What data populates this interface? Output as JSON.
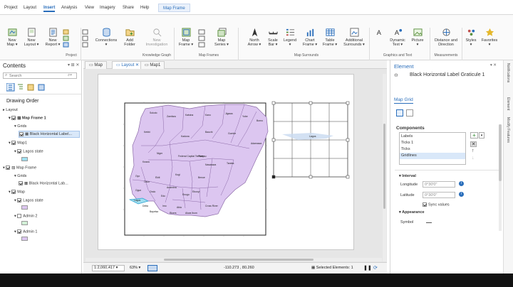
{
  "ribbon_tabs": [
    "Project",
    "Layout",
    "Insert",
    "Analysis",
    "View",
    "Imagery",
    "Share",
    "Help",
    "Map Frame"
  ],
  "ribbon": {
    "new_map": "New\nMap ▾",
    "new_layout": "New\nLayout ▾",
    "new_report": "New\nReport ▾",
    "connections": "Connections\n▾",
    "add_folder": "Add\nFolder",
    "new_investigation": "New\nInvestigation",
    "map_frame": "Map\nFrame ▾",
    "map_series": "Map\nSeries ▾",
    "north_arrow": "North\nArrow ▾",
    "scale_bar": "Scale\nBar ▾",
    "legend": "Legend\n▾",
    "chart_frame": "Chart\nFrame ▾",
    "table_frame": "Table\nFrame ▾",
    "additional_surrounds": "Additional\nSurrounds ▾",
    "dynamic_text": "Dynamic\nText ▾",
    "picture": "Picture\n▾",
    "distance_direction": "Distance and\nDirection",
    "styles": "Styles\n▾",
    "favorites": "Favorites\n▾",
    "groups": {
      "project": "Project",
      "knowledge_graph": "Knowledge Graph",
      "map_frames": "Map Frames",
      "map_surrounds": "Map Surrounds",
      "graphics_text": "Graphics and Text",
      "measurements": "Measurements"
    }
  },
  "contents": {
    "title": "Contents",
    "search_placeholder": "Search",
    "drawing_order": "Drawing Order",
    "items": [
      "Layout",
      "Map Frame 1",
      "Grids",
      "Black Horizontal Label...",
      "Map1",
      "Lagos state",
      "Map Frame",
      "Grids",
      "Black Horizontal Lab...",
      "Map",
      "Lagos state",
      "Admin 2",
      "Admin 1"
    ]
  },
  "doc_tabs": [
    "Map",
    "Layout",
    "Map1"
  ],
  "status": {
    "scale": "1:2,060,417",
    "zoom": "63%",
    "coords": "-110.273 , 80.260",
    "selected": "Selected Elements: 1"
  },
  "element": {
    "pane_title": "Element",
    "subtitle": "Black Horizontal Label Graticule 1",
    "section": "Map Grid",
    "components_label": "Components",
    "components": [
      "Labels",
      "Ticks 1",
      "Ticks",
      "Gridlines"
    ],
    "interval_label": "Interval",
    "longitude_label": "Longitude",
    "longitude_value": "0°30'0\"",
    "latitude_label": "Latitude",
    "latitude_value": "0°30'0\"",
    "sync_label": "Sync values",
    "appearance_label": "Appearance",
    "symbol_label": "Symbol"
  },
  "rail": [
    "Notifications",
    "Element",
    "Modify Features"
  ],
  "map": {
    "states": [
      "Sokoto",
      "Zamfara",
      "Katsina",
      "Kano",
      "Jigawa",
      "Yobe",
      "Borno",
      "Kebbi",
      "Kaduna",
      "Bauchi",
      "Gombe",
      "Adamawa",
      "Niger",
      "Federal Capital Territory",
      "Plateau",
      "Taraba",
      "Kwara",
      "Nasarawa",
      "Oyo",
      "Ogun",
      "Lagos",
      "Osun",
      "Ekiti",
      "Kogi",
      "Benue",
      "Ondo",
      "Edo",
      "Enugu",
      "Anambra",
      "Delta",
      "Imo",
      "Abia",
      "Bayelsa",
      "Rivers",
      "Akwa Ibom",
      "Cross River",
      "Ebonyi"
    ],
    "inset_label": "Lagos"
  },
  "colors": {
    "accent": "#2a6ebb",
    "state_fill": "#dcc6f0",
    "state_stroke": "#8c6aa8",
    "lagos": "#9fdff0"
  }
}
